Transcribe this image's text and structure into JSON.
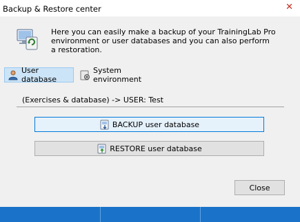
{
  "window": {
    "title": "Backup & Restore center",
    "close_glyph": "✕"
  },
  "intro": {
    "icon": "backup-computer-icon",
    "lines": [
      "Here you can easily make a backup of your TrainingLab Pro",
      "environment or user databases and you can also perform",
      "a restoration."
    ]
  },
  "tabs": [
    {
      "label": "User database",
      "icon": "user-icon",
      "active": true
    },
    {
      "label": "System environment",
      "icon": "system-disk-icon",
      "active": false
    }
  ],
  "info": {
    "text": "(Exercises & database) -> USER: Test"
  },
  "buttons": {
    "backup": {
      "label": "BACKUP user database",
      "icon": "database-backup-icon"
    },
    "restore": {
      "label": "RESTORE user database",
      "icon": "database-restore-icon"
    },
    "close": {
      "label": "Close"
    }
  },
  "colors": {
    "accent": "#0078d7",
    "statusbar": "#1a73c9",
    "tab_active": "#cce4f7"
  }
}
